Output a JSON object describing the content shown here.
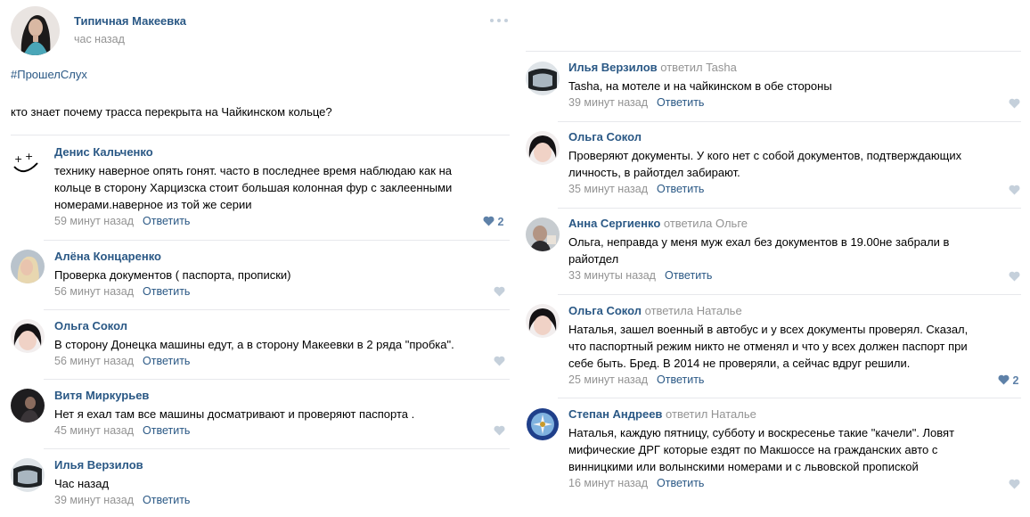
{
  "post": {
    "author": "Типичная Макеевка",
    "time": "час назад",
    "hashtag": "#ПрошелСлух",
    "text": "кто знает почему трасса перекрыта на Чайкинском кольце?"
  },
  "comments_left": [
    {
      "author": "Денис Кальченко",
      "reply_to": "",
      "lines": [
        "технику наверное опять гонят. часто в последнее время наблюдаю как на",
        "кольце в сторону Харцизска стоит большая колонная фур с заклеенными",
        "номерами.наверное из той же серии"
      ],
      "time": "59 минут назад",
      "reply_label": "Ответить",
      "likes": "2"
    },
    {
      "author": "Алёна Концаренко",
      "reply_to": "",
      "lines": [
        "Проверка документов ( паспорта, прописки)"
      ],
      "time": "56 минут назад",
      "reply_label": "Ответить",
      "likes": ""
    },
    {
      "author": "Ольга Сокол",
      "reply_to": "",
      "lines": [
        "В сторону Донецка машины едут, а в сторону Макеевки в 2 ряда \"пробка\"."
      ],
      "time": "56 минут назад",
      "reply_label": "Ответить",
      "likes": ""
    },
    {
      "author": "Витя Миркурьев",
      "reply_to": "",
      "lines": [
        "Нет я ехал там все машины досматривают и проверяют паспорта ."
      ],
      "time": "45 минут назад",
      "reply_label": "Ответить",
      "likes": ""
    },
    {
      "author": "Илья Верзилов",
      "reply_to": "",
      "lines": [
        "Час назад"
      ],
      "time": "39 минут назад",
      "reply_label": "Ответить",
      "likes": ""
    }
  ],
  "comments_right": [
    {
      "author": "Илья Верзилов",
      "reply_to": "ответил Tasha",
      "lines": [
        "Tasha, на мотеле и на чайкинском в обе стороны"
      ],
      "time": "39 минут назад",
      "reply_label": "Ответить",
      "likes": ""
    },
    {
      "author": "Ольга Сокол",
      "reply_to": "",
      "lines": [
        "Проверяют документы. У кого нет с собой документов, подтверждающих",
        "личность, в райотдел забирают."
      ],
      "time": "35 минут назад",
      "reply_label": "Ответить",
      "likes": ""
    },
    {
      "author": "Анна Сергиенко",
      "reply_to": "ответила Ольге",
      "lines": [
        "Ольга, неправда у меня муж ехал без документов в 19.00не забрали в",
        "райотдел"
      ],
      "time": "33 минуты назад",
      "reply_label": "Ответить",
      "likes": ""
    },
    {
      "author": "Ольга Сокол",
      "reply_to": "ответила Наталье",
      "lines": [
        "Наталья, зашел военный в автобус и у всех документы проверял. Сказал,",
        "что паспортный режим никто не отменял и что у всех должен паспорт при",
        "себе быть. Бред. В 2014 не проверяли, а сейчас вдруг решили."
      ],
      "time": "25 минут назад",
      "reply_label": "Ответить",
      "likes": "2"
    },
    {
      "author": "Степан Андреев",
      "reply_to": "ответил Наталье",
      "lines": [
        "Наталья, каждую пятницу, субботу и воскресенье такие \"качели\". Ловят",
        "мифические ДРГ которые ездят по Макшоссе на гражданских авто с",
        "винницкими или волынскими номерами и с львовской пропиской"
      ],
      "time": "16 минут назад",
      "reply_label": "Ответить",
      "likes": ""
    }
  ],
  "colors": {
    "link": "#2a5885",
    "meta": "#939393",
    "separator": "#e7e8ec",
    "heart": "#c5d0db",
    "heart_active": "#5e81a8"
  }
}
